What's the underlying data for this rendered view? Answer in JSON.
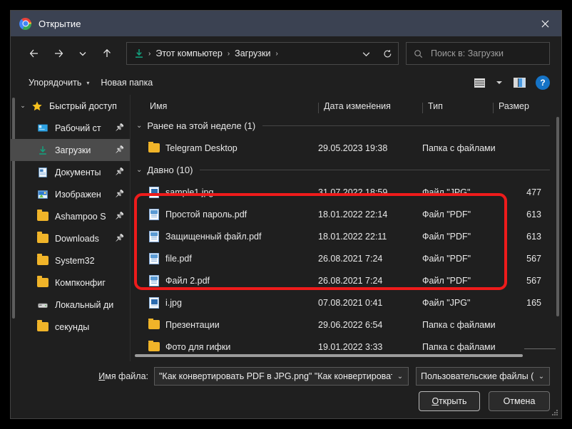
{
  "window": {
    "title": "Открытие",
    "app_icon": "chrome-icon",
    "close_icon": "close-icon"
  },
  "nav": {
    "back_icon": "arrow-left-icon",
    "forward_icon": "arrow-right-icon",
    "recent_icon": "chevron-down-icon",
    "up_icon": "arrow-up-icon",
    "address_icon": "downloads-icon",
    "crumbs": [
      "Этот компьютер",
      "Загрузки"
    ],
    "separator": "›",
    "dropdown_icon": "chevron-down-icon",
    "refresh_icon": "refresh-icon"
  },
  "search": {
    "placeholder": "Поиск в: Загрузки",
    "value": "",
    "icon": "search-icon"
  },
  "commandbar": {
    "organize_label": "Упорядочить",
    "organize_caret": "▾",
    "new_folder_label": "Новая папка",
    "view_icon": "list-view-icon",
    "view_caret_icon": "chevron-down-icon",
    "preview_pane_icon": "preview-pane-icon",
    "help_label": "?",
    "help_icon": "help-icon"
  },
  "sidebar": {
    "items": [
      {
        "label": "Быстрый доступ",
        "icon": "star-icon",
        "level": "root",
        "expanded": true,
        "pinned": false,
        "selected": false
      },
      {
        "label": "Рабочий ст",
        "icon": "desktop-icon",
        "level": "child",
        "pinned": true,
        "selected": false
      },
      {
        "label": "Загрузки",
        "icon": "downloads-icon",
        "level": "child",
        "pinned": true,
        "selected": true
      },
      {
        "label": "Документы",
        "icon": "documents-icon",
        "level": "child",
        "pinned": true,
        "selected": false
      },
      {
        "label": "Изображен",
        "icon": "pictures-icon",
        "level": "child",
        "pinned": true,
        "selected": false
      },
      {
        "label": "Ashampoo S",
        "icon": "folder-icon",
        "level": "child",
        "pinned": true,
        "selected": false
      },
      {
        "label": "Downloads",
        "icon": "folder-icon",
        "level": "child",
        "pinned": true,
        "selected": false
      },
      {
        "label": "System32",
        "icon": "folder-icon",
        "level": "child",
        "pinned": false,
        "selected": false
      },
      {
        "label": "Компконфиг",
        "icon": "folder-icon",
        "level": "child",
        "pinned": false,
        "selected": false
      },
      {
        "label": "Локальный ди",
        "icon": "drive-icon",
        "level": "child",
        "pinned": false,
        "selected": false
      },
      {
        "label": "секунды",
        "icon": "folder-icon",
        "level": "child",
        "pinned": false,
        "selected": false
      }
    ]
  },
  "columns": [
    {
      "label": "Имя",
      "sorted": false
    },
    {
      "label": "Дата изменения",
      "sorted": true,
      "sort_glyph": "⌄"
    },
    {
      "label": "Тип",
      "sorted": false
    },
    {
      "label": "Размер",
      "sorted": false
    }
  ],
  "groups": [
    {
      "header": "Ранее на этой неделе (1)",
      "chevron": "⌄",
      "rows": [
        {
          "name": "Telegram Desktop",
          "icon": "folder-icon",
          "date": "29.05.2023 19:38",
          "type": "Папка с файлами",
          "size": ""
        }
      ]
    },
    {
      "header": "Давно (10)",
      "chevron": "⌄",
      "rows": [
        {
          "name": "sample1.jpg",
          "icon": "jpg-file-icon",
          "date": "31.07.2022 18:59",
          "type": "Файл \"JPG\"",
          "size": "477"
        },
        {
          "name": "Простой пароль.pdf",
          "icon": "pdf-file-icon",
          "date": "18.01.2022 22:14",
          "type": "Файл \"PDF\"",
          "size": "613"
        },
        {
          "name": "Защищенный файл.pdf",
          "icon": "pdf-file-icon",
          "date": "18.01.2022 22:11",
          "type": "Файл \"PDF\"",
          "size": "613"
        },
        {
          "name": "file.pdf",
          "icon": "pdf-file-icon",
          "date": "26.08.2021 7:24",
          "type": "Файл \"PDF\"",
          "size": "567"
        },
        {
          "name": "Файл 2.pdf",
          "icon": "pdf-file-icon",
          "date": "26.08.2021 7:24",
          "type": "Файл \"PDF\"",
          "size": "567"
        },
        {
          "name": "i.jpg",
          "icon": "jpg-file-icon",
          "date": "07.08.2021 0:41",
          "type": "Файл \"JPG\"",
          "size": "165"
        },
        {
          "name": "Презентации",
          "icon": "folder-icon",
          "date": "29.06.2022 6:54",
          "type": "Папка с файлами",
          "size": ""
        },
        {
          "name": "Фото для гифки",
          "icon": "folder-icon",
          "date": "19.01.2022 3:33",
          "type": "Папка с файлами",
          "size": ""
        }
      ]
    }
  ],
  "annotation": {
    "color": "#ee1b1b",
    "shape": "rounded-rectangle"
  },
  "footer": {
    "filename_label_prefix": "И",
    "filename_label_rest": "мя файла:",
    "filename_value": "\"Как конвертировать PDF в JPG.png\" \"Как конвертировать P",
    "filename_chevron": "⌄",
    "filter_value": "Пользовательские файлы (*.p",
    "filter_chevron": "⌄",
    "open_prefix": "О",
    "open_rest": "ткрыть",
    "cancel_label": "Отмена",
    "resize_grip_icon": "resize-grip-icon"
  }
}
